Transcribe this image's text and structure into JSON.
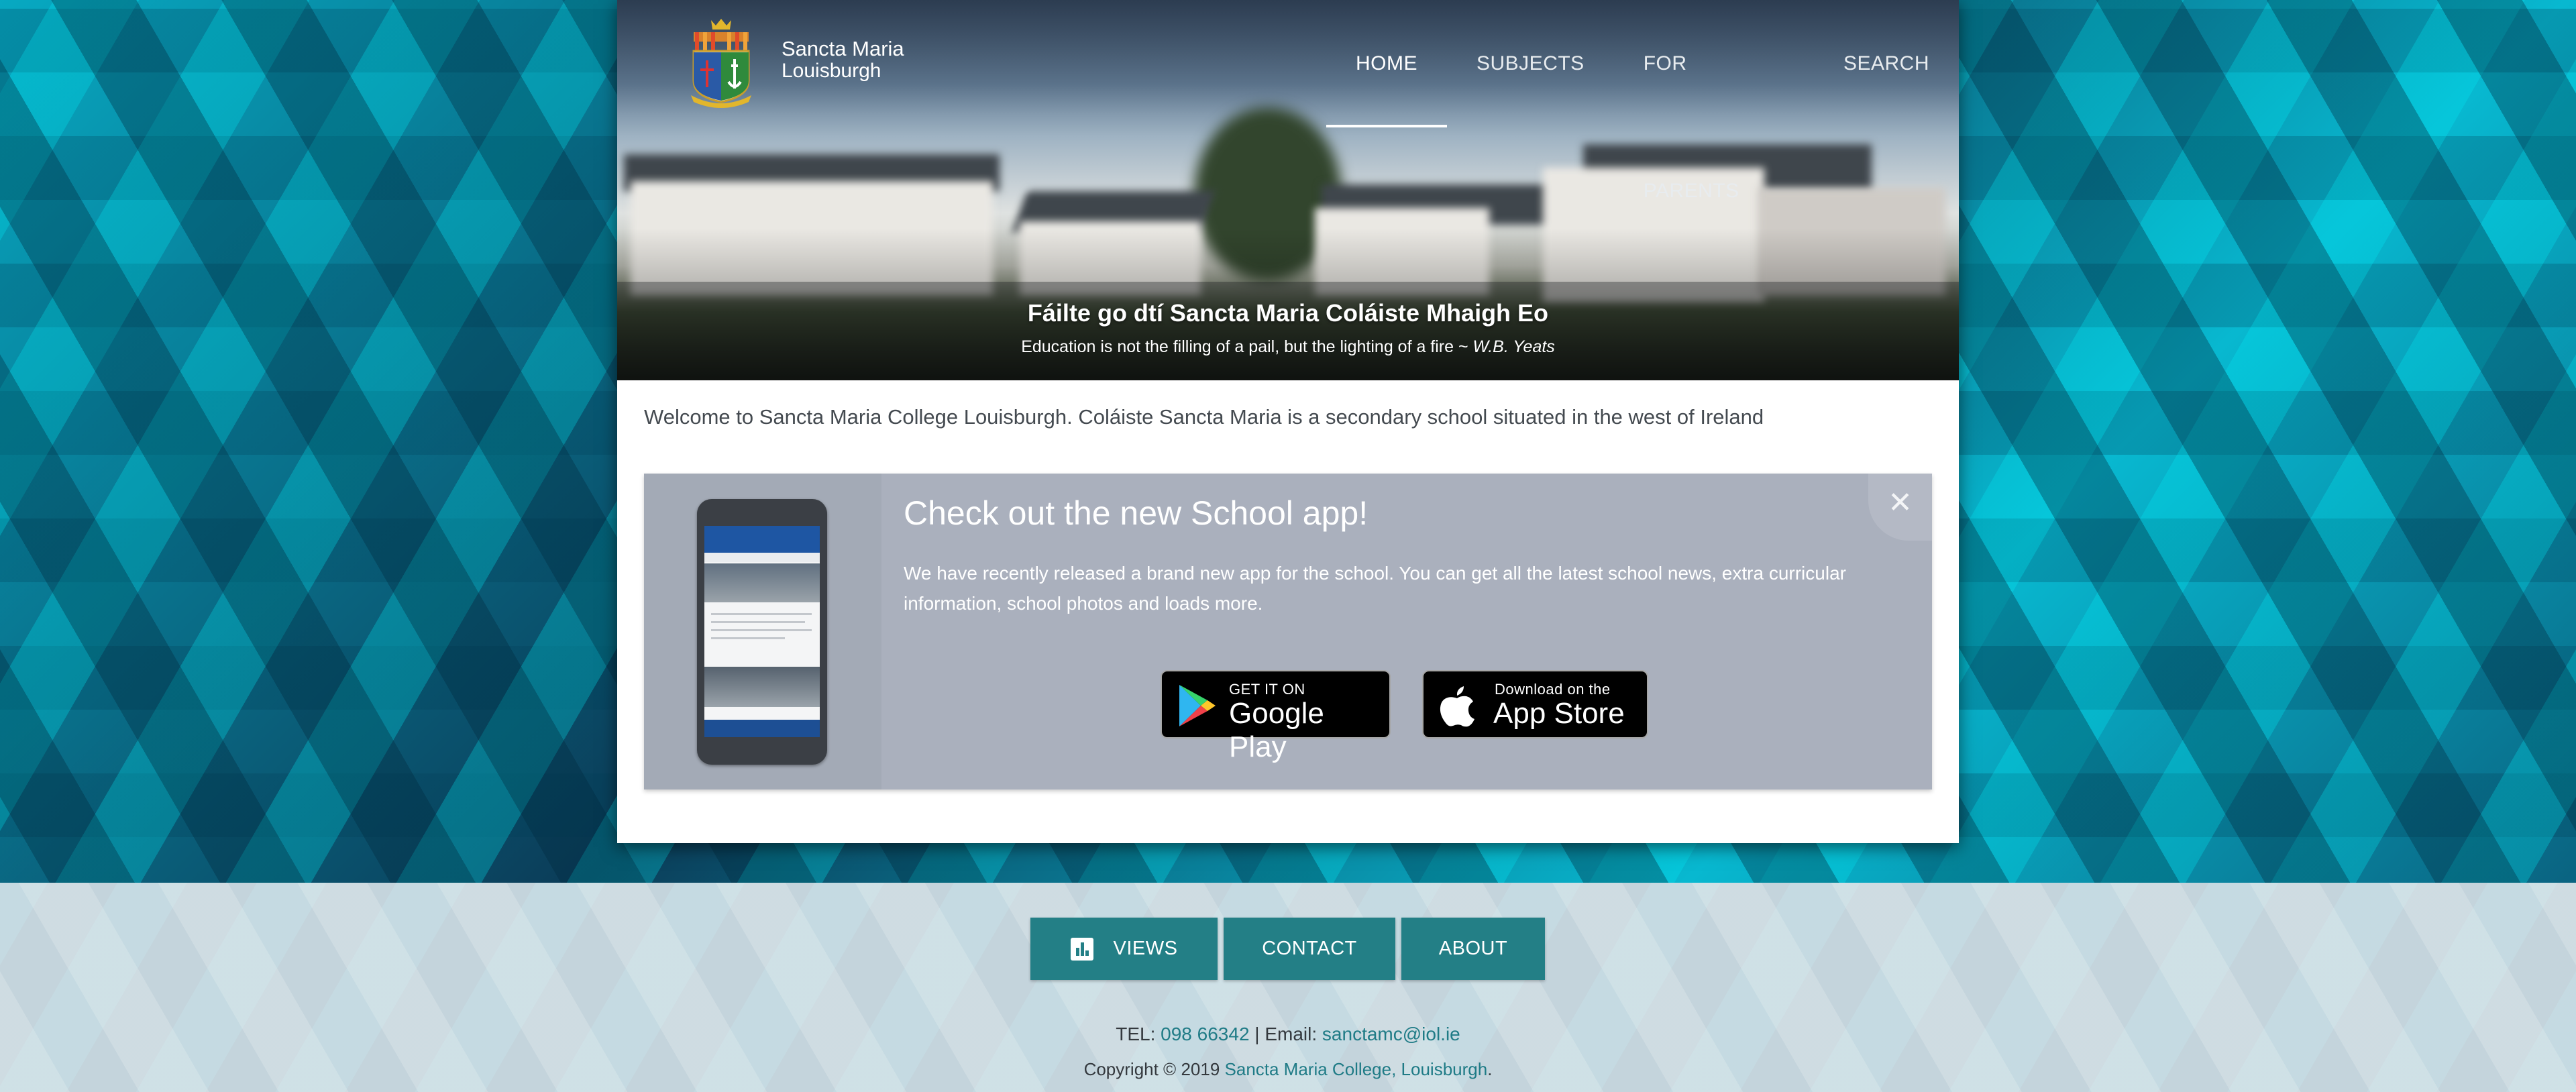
{
  "header": {
    "brand_name": "Sancta Maria",
    "brand_sub": "Louisburgh",
    "nav": [
      {
        "label": "HOME",
        "active": true
      },
      {
        "label": "SUBJECTS"
      },
      {
        "label": "FOR PARENTS"
      },
      {
        "label": "SEARCH"
      }
    ]
  },
  "hero": {
    "title": "Fáilte go dtí Sancta Maria Coláiste Mhaigh Eo",
    "quote": "Education is not the filling of a pail, but the lighting of a fire ~ ",
    "quote_author": "W.B. Yeats"
  },
  "welcome": "Welcome to Sancta Maria College Louisburgh. Coláiste Sancta Maria is a secondary school situated in the west of Ireland",
  "app_promo": {
    "title": "Check out the new School app!",
    "text": "We have recently released a brand new app for the school. You can get all the latest school news, extra curricular information, school photos and loads more.",
    "google_play": {
      "small": "GET IT ON",
      "big": "Google Play"
    },
    "app_store": {
      "small": "Download on the",
      "big": "App Store"
    },
    "close_icon": "close-icon"
  },
  "footer": {
    "buttons": {
      "views": "VIEWS",
      "contact": "CONTACT",
      "about": "ABOUT"
    },
    "tel_label": "TEL: ",
    "tel": "098 66342",
    "email_label": " | Email: ",
    "email": "sanctamc@iol.ie",
    "copyright": "Copyright © 2019 ",
    "copyright_link": "Sancta Maria College, Louisburgh",
    "copyright_end": "."
  },
  "colors": {
    "accent": "#237f86",
    "promo_bg": "#aab0bd"
  }
}
